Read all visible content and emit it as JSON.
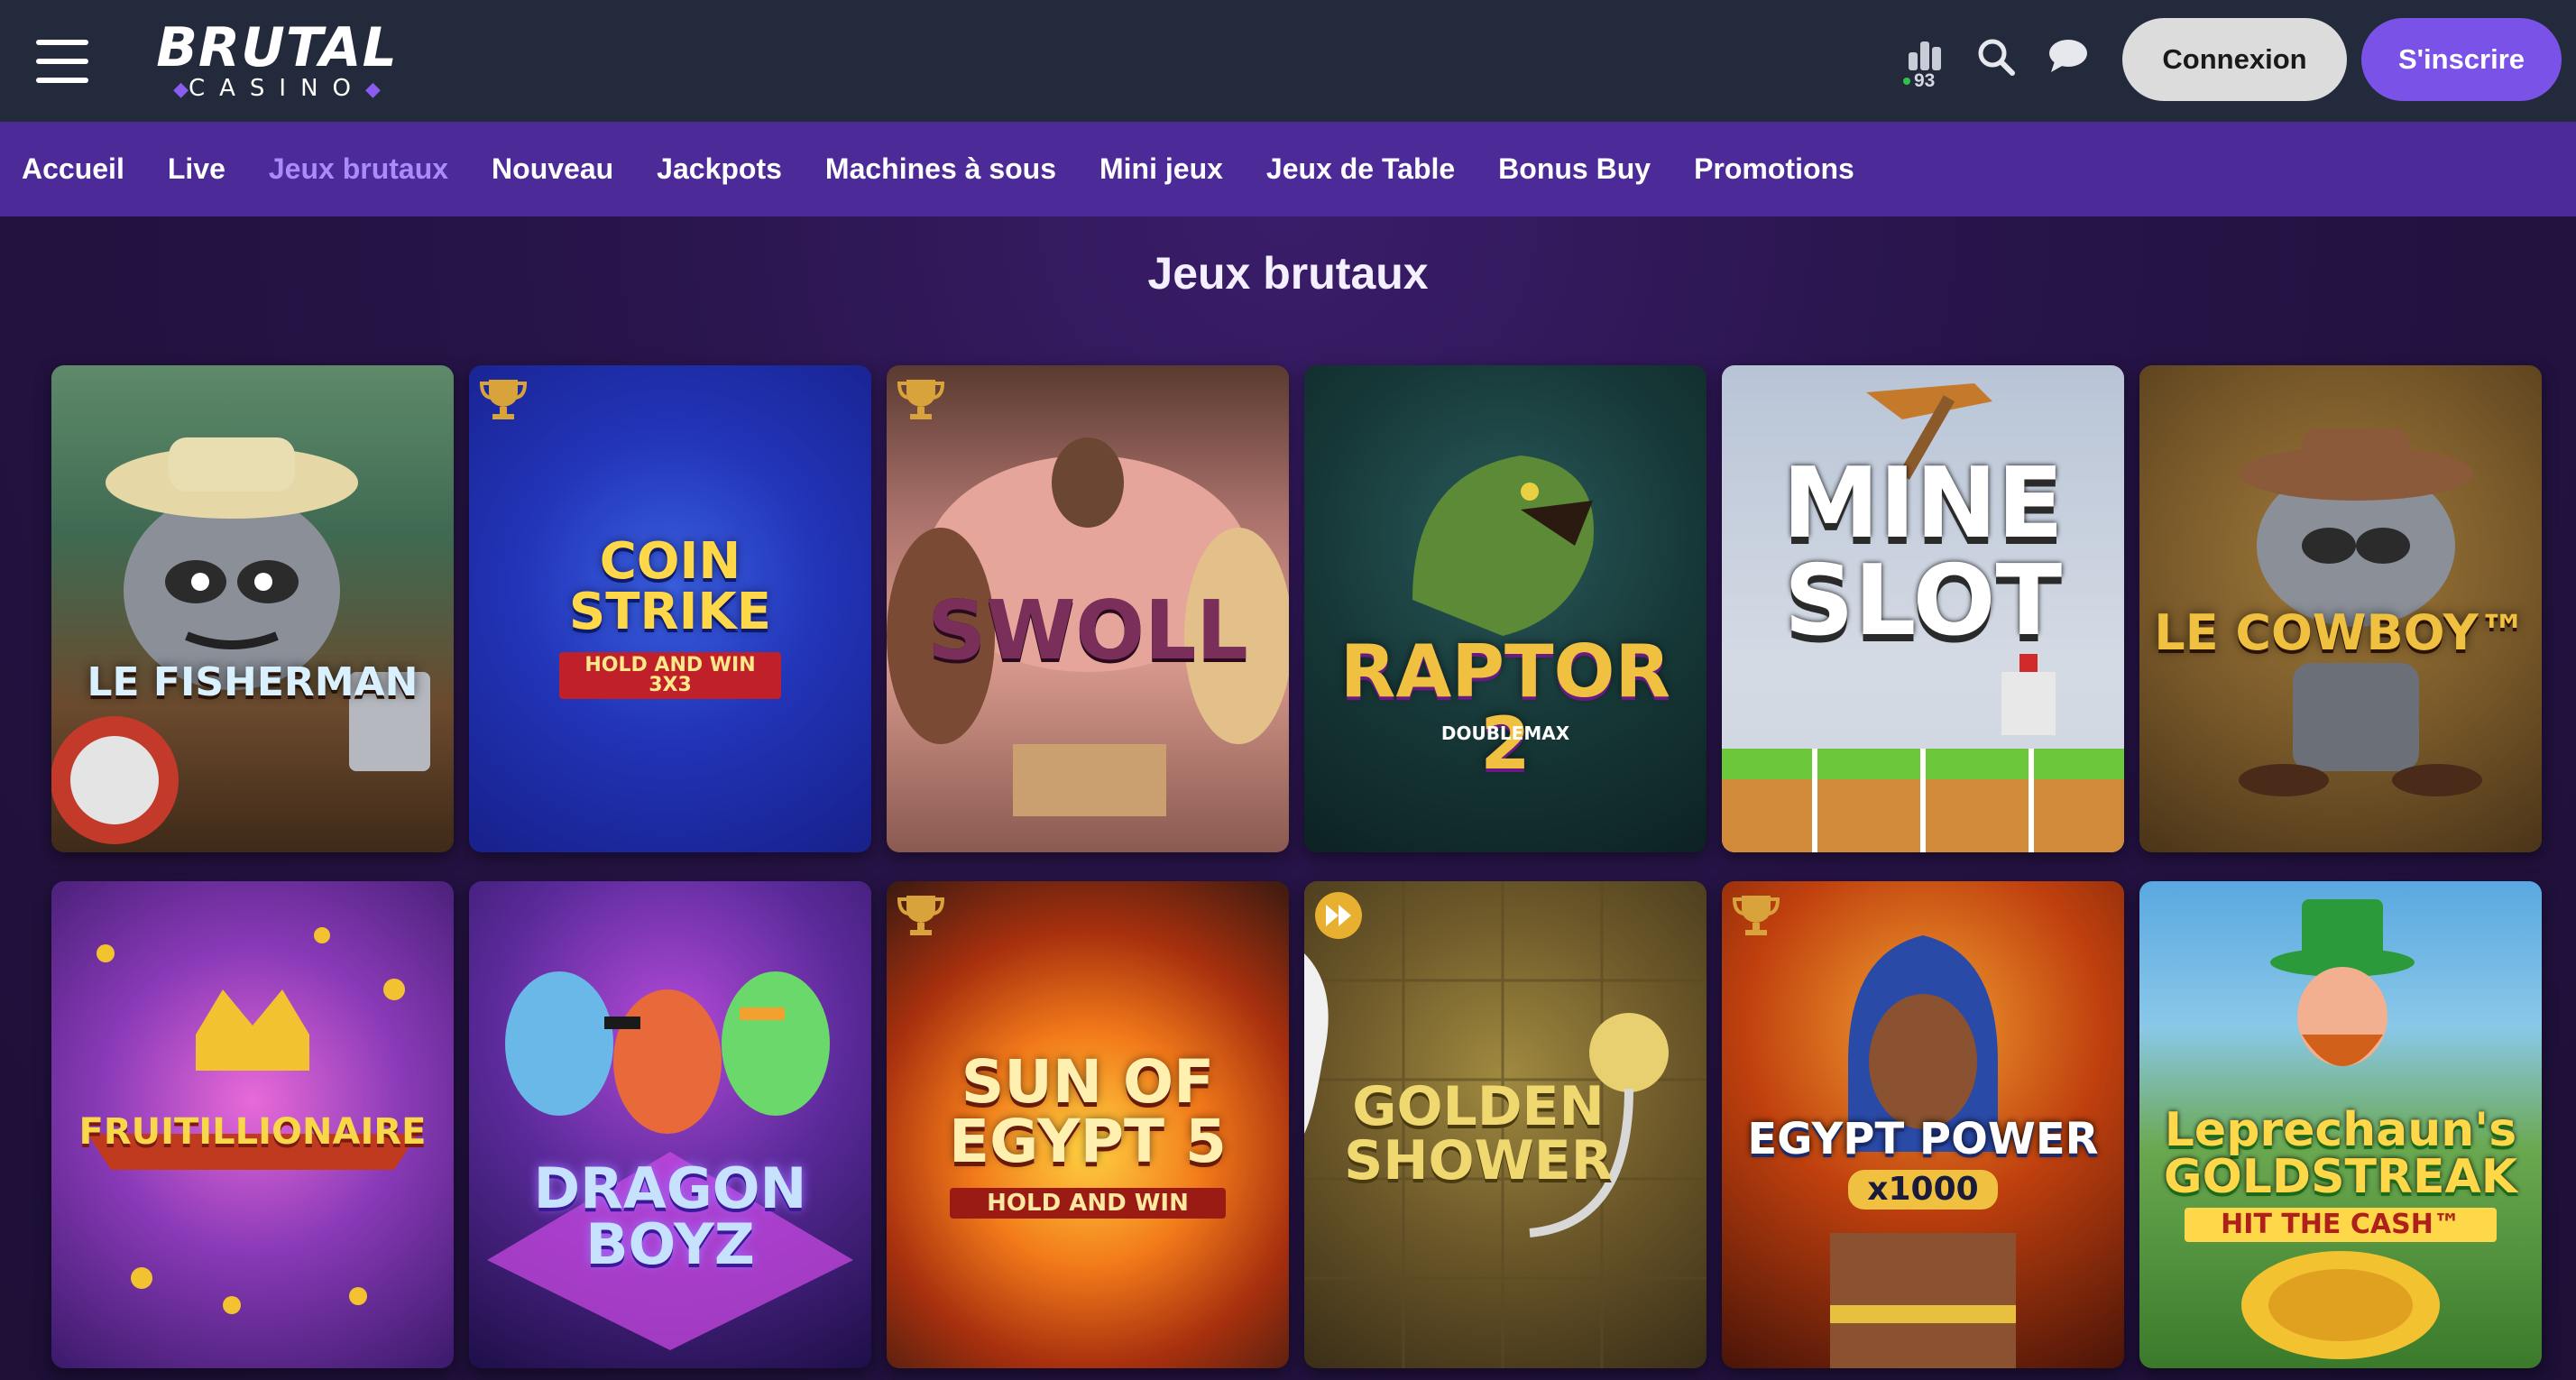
{
  "header": {
    "logo_main": "BRUTAL",
    "logo_sub": "CASINO",
    "stats_count": "93",
    "login_label": "Connexion",
    "signup_label": "S'inscrire",
    "accent_color": "#7b52e8"
  },
  "nav": {
    "items": [
      {
        "label": "Accueil",
        "active": false
      },
      {
        "label": "Live",
        "active": false
      },
      {
        "label": "Jeux brutaux",
        "active": true
      },
      {
        "label": "Nouveau",
        "active": false
      },
      {
        "label": "Jackpots",
        "active": false
      },
      {
        "label": "Machines à sous",
        "active": false
      },
      {
        "label": "Mini jeux",
        "active": false
      },
      {
        "label": "Jeux de Table",
        "active": false
      },
      {
        "label": "Bonus Buy",
        "active": false
      },
      {
        "label": "Promotions",
        "active": false
      }
    ]
  },
  "main": {
    "title": "Jeux brutaux",
    "games": [
      {
        "title": "LE FISHERMAN",
        "badge": "",
        "icon": "raccoon-fisherman-art"
      },
      {
        "title": "COIN\nSTRIKE",
        "subtitle": "HOLD AND WIN 3X3",
        "badge": "trophy-icon",
        "icon": "coin-strike-art"
      },
      {
        "title": "SWOLL",
        "badge": "trophy-icon",
        "icon": "swoll-art"
      },
      {
        "title": "RAPTOR 2",
        "subtitle": "DOUBLEMAX",
        "badge": "",
        "icon": "raptor-art"
      },
      {
        "title": "MINE\nSLOT",
        "badge": "",
        "icon": "mine-slot-art"
      },
      {
        "title": "LE COWBOY™",
        "badge": "",
        "icon": "raccoon-cowboy-art"
      },
      {
        "title": "FRUITILLIONAIRE",
        "badge": "",
        "icon": "fruitillionaire-art"
      },
      {
        "title": "DRAGON\nBOYZ",
        "badge": "",
        "icon": "dragon-boyz-art"
      },
      {
        "title": "SUN OF\nEGYPT 5",
        "subtitle": "HOLD AND WIN",
        "badge": "trophy-icon",
        "icon": "sun-of-egypt-art"
      },
      {
        "title": "GOLDEN\nSHOWER",
        "badge": "fast-forward-icon",
        "icon": "golden-shower-art"
      },
      {
        "title": "EGYPT POWER",
        "subtitle": "x1000",
        "badge": "trophy-icon",
        "icon": "egypt-power-art"
      },
      {
        "title": "Leprechaun's\nGOLDSTREAK",
        "subtitle": "HIT THE CASH™",
        "badge": "",
        "icon": "leprechaun-art"
      }
    ]
  }
}
